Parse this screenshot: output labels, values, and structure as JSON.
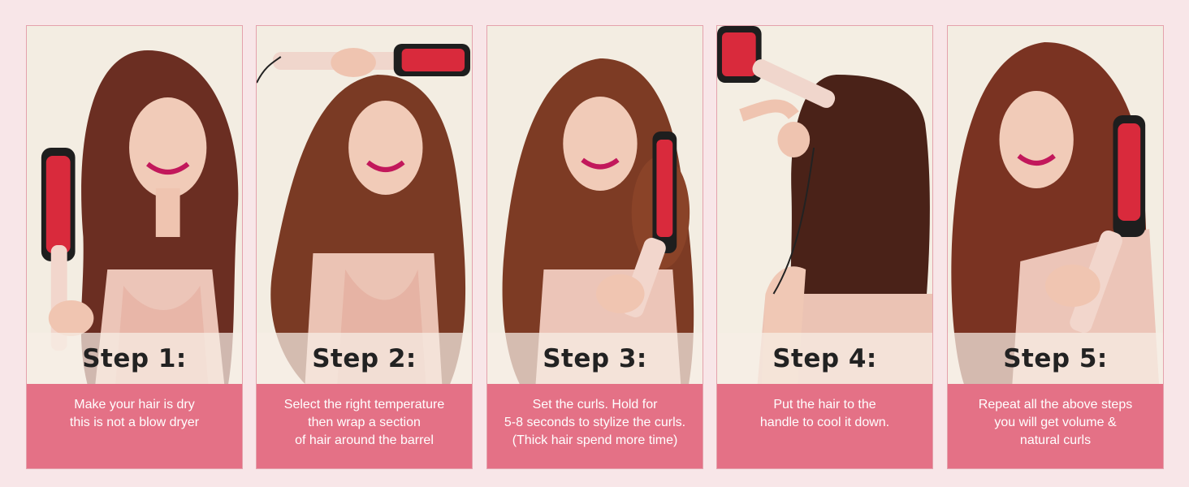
{
  "colors": {
    "background": "#f8e6e8",
    "panel_border": "#e4a2ac",
    "description_bg": "#e47186",
    "step_text": "#222222",
    "description_text": "#ffffff"
  },
  "steps": [
    {
      "title": "Step 1:",
      "lines": [
        "Make your hair is dry",
        "this is not a blow dryer"
      ],
      "image": "woman-holding-round-brush-straight-hair"
    },
    {
      "title": "Step 2:",
      "lines": [
        "Select the right temperature",
        "then wrap a section",
        "of hair around the barrel"
      ],
      "image": "woman-wrapping-hair-around-barrel"
    },
    {
      "title": "Step 3:",
      "lines": [
        "Set the curls. Hold for",
        "5-8 seconds to stylize the curls.",
        "(Thick hair spend more time)"
      ],
      "image": "woman-holding-brush-in-curls"
    },
    {
      "title": "Step 4:",
      "lines": [
        "Put the hair to the",
        "handle to cool it down."
      ],
      "image": "back-view-hair-on-handle"
    },
    {
      "title": "Step 5:",
      "lines": [
        "Repeat all the above steps",
        "you will get volume &",
        "natural curls"
      ],
      "image": "woman-with-voluminous-curls"
    }
  ]
}
